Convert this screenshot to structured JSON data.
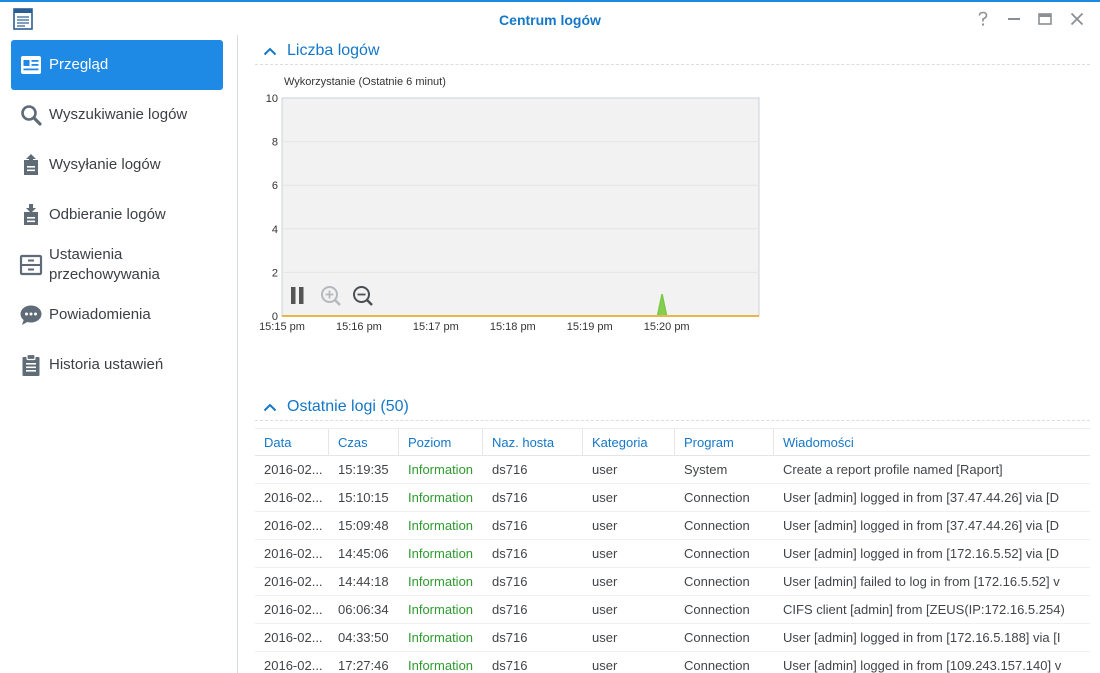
{
  "window": {
    "title": "Centrum logów",
    "controls": [
      "help-icon",
      "minimize-icon",
      "maximize-icon",
      "close-icon"
    ]
  },
  "sidebar": {
    "items": [
      {
        "label": "Przegląd",
        "icon": "overview-icon",
        "active": true
      },
      {
        "label": "Wyszukiwanie logów",
        "icon": "search-icon"
      },
      {
        "label": "Wysyłanie logów",
        "icon": "upload-icon"
      },
      {
        "label": "Odbieranie logów",
        "icon": "download-icon"
      },
      {
        "label": "Ustawienia przechowywania",
        "icon": "storage-icon"
      },
      {
        "label": "Powiadomienia",
        "icon": "chat-icon"
      },
      {
        "label": "Historia ustawień",
        "icon": "clipboard-icon"
      }
    ]
  },
  "log_count": {
    "title": "Liczba logów"
  },
  "chart_data": {
    "type": "area",
    "title": "Wykorzystanie (Ostatnie 6 minut)",
    "xlabel": "",
    "ylabel": "",
    "x_ticks": [
      "15:15 pm",
      "15:16 pm",
      "15:17 pm",
      "15:18 pm",
      "15:19 pm",
      "15:20 pm"
    ],
    "y_ticks": [
      0,
      2,
      4,
      6,
      8,
      10
    ],
    "ylim": [
      0,
      10
    ],
    "x_range_minutes": [
      0,
      6.2
    ],
    "series": [
      {
        "points": [
          [
            0,
            0
          ],
          [
            4.88,
            0
          ],
          [
            4.94,
            1
          ],
          [
            5.0,
            0
          ],
          [
            6.2,
            0
          ]
        ],
        "color": "#7ac943"
      }
    ],
    "grid": true,
    "controls": [
      "pause-icon",
      "zoom-in-icon",
      "zoom-out-icon"
    ],
    "colors": {
      "plot_bg": "#f2f2f2",
      "baseline": "#e8b64a",
      "grid": "#e4e4e4"
    }
  },
  "recent_logs": {
    "title": "Ostatnie logi (50)",
    "columns": [
      "Data",
      "Czas",
      "Poziom",
      "Naz. hosta",
      "Kategoria",
      "Program",
      "Wiadomości"
    ],
    "rows": [
      [
        "2016-02...",
        "15:19:35",
        "Information",
        "ds716",
        "user",
        "System",
        "Create a report profile named [Raport]"
      ],
      [
        "2016-02...",
        "15:10:15",
        "Information",
        "ds716",
        "user",
        "Connection",
        "User [admin] logged in from [37.47.44.26] via [D"
      ],
      [
        "2016-02...",
        "15:09:48",
        "Information",
        "ds716",
        "user",
        "Connection",
        "User [admin] logged in from [37.47.44.26] via [D"
      ],
      [
        "2016-02...",
        "14:45:06",
        "Information",
        "ds716",
        "user",
        "Connection",
        "User [admin] logged in from [172.16.5.52] via [D"
      ],
      [
        "2016-02...",
        "14:44:18",
        "Information",
        "ds716",
        "user",
        "Connection",
        "User [admin] failed to log in from [172.16.5.52] v"
      ],
      [
        "2016-02...",
        "06:06:34",
        "Information",
        "ds716",
        "user",
        "Connection",
        "CIFS client [admin] from [ZEUS(IP:172.16.5.254)"
      ],
      [
        "2016-02...",
        "04:33:50",
        "Information",
        "ds716",
        "user",
        "Connection",
        "User [admin] logged in from [172.16.5.188] via [I"
      ],
      [
        "2016-02...",
        "17:27:46",
        "Information",
        "ds716",
        "user",
        "Connection",
        "User [admin] logged in from [109.243.157.140] v"
      ]
    ]
  }
}
